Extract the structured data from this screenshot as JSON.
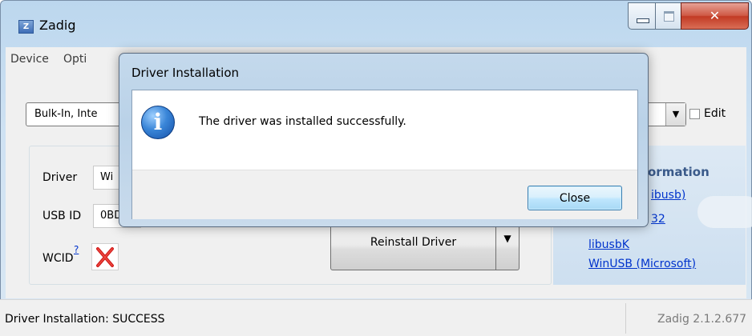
{
  "window": {
    "title": "Zadig",
    "icon_letter": "Z"
  },
  "menu": {
    "items": [
      {
        "label": "Device"
      },
      {
        "label": "Opti"
      }
    ]
  },
  "device": {
    "selected": "Bulk-In, Inte",
    "edit_label": "Edit",
    "edit_checked": false
  },
  "driver_panel": {
    "driver_label": "Driver",
    "driver_value": "Wi",
    "usbid_label": "USB ID",
    "usbid_value": "0BD",
    "wcid_label": "WCID",
    "wcid_help": "?",
    "wcid_status": "cross-icon"
  },
  "actions": {
    "reinstall_label": "Reinstall Driver"
  },
  "info": {
    "heading": "ormation",
    "links": [
      "ibusb)",
      "32",
      "libusbK",
      "WinUSB (Microsoft)"
    ]
  },
  "status": {
    "text": "Driver Installation: SUCCESS",
    "version": "Zadig 2.1.2.677"
  },
  "dialog": {
    "title": "Driver Installation",
    "message": "The driver was installed successfully.",
    "icon": "information-icon",
    "icon_glyph": "i",
    "close_label": "Close"
  },
  "colors": {
    "link": "#0033cc",
    "title_bar": "#bcd7ee",
    "close_button": "#c23a24",
    "error_red": "#d21b1b"
  }
}
